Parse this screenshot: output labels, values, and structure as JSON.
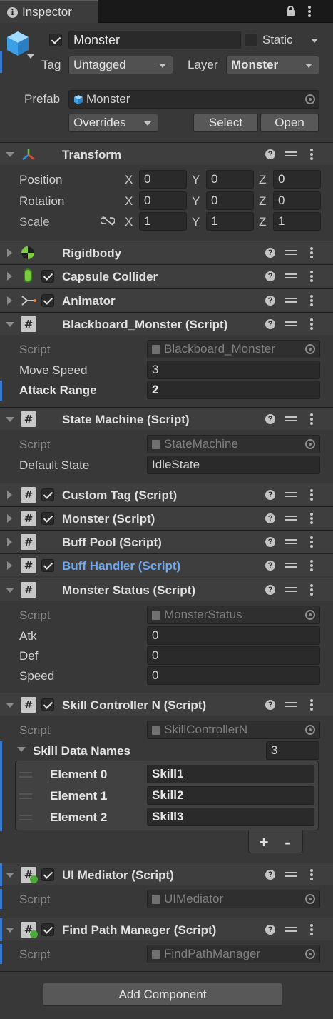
{
  "tab": {
    "title": "Inspector"
  },
  "object": {
    "name": "Monster",
    "static_label": "Static",
    "tag_label": "Tag",
    "tag_value": "Untagged",
    "layer_label": "Layer",
    "layer_value": "Monster",
    "prefab_label": "Prefab",
    "prefab_value": "Monster",
    "overrides": "Overrides",
    "select": "Select",
    "open": "Open"
  },
  "transform": {
    "title": "Transform",
    "position_label": "Position",
    "rotation_label": "Rotation",
    "scale_label": "Scale",
    "x": "X",
    "y": "Y",
    "z": "Z",
    "position": [
      "0",
      "0",
      "0"
    ],
    "rotation": [
      "0",
      "0",
      "0"
    ],
    "scale": [
      "1",
      "1",
      "1"
    ]
  },
  "components": {
    "rigidbody": "Rigidbody",
    "capsule": "Capsule Collider",
    "animator": "Animator",
    "blackboard": {
      "title": "Blackboard_Monster (Script)",
      "script_label": "Script",
      "script_value": "Blackboard_Monster",
      "move_label": "Move Speed",
      "move_value": "3",
      "attack_label": "Attack Range",
      "attack_value": "2"
    },
    "state_machine": {
      "title": "State Machine (Script)",
      "script_label": "Script",
      "script_value": "StateMachine",
      "default_label": "Default State",
      "default_value": "IdleState"
    },
    "custom_tag": "Custom Tag (Script)",
    "monster": "Monster (Script)",
    "buff_pool": "Buff Pool (Script)",
    "buff_handler": "Buff Handler (Script)",
    "monster_status": {
      "title": "Monster Status (Script)",
      "script_label": "Script",
      "script_value": "MonsterStatus",
      "atk_label": "Atk",
      "atk_value": "0",
      "def_label": "Def",
      "def_value": "0",
      "speed_label": "Speed",
      "speed_value": "0"
    },
    "skill_controller": {
      "title": "Skill Controller N (Script)",
      "script_label": "Script",
      "script_value": "SkillControllerN",
      "list_label": "Skill Data Names",
      "list_size": "3",
      "elements": [
        {
          "label": "Element 0",
          "value": "Skill1"
        },
        {
          "label": "Element 1",
          "value": "Skill2"
        },
        {
          "label": "Element 2",
          "value": "Skill3"
        }
      ],
      "plus": "+",
      "minus": "-"
    },
    "ui_mediator": {
      "title": "UI Mediator (Script)",
      "script_label": "Script",
      "script_value": "UIMediator"
    },
    "find_path": {
      "title": "Find Path Manager (Script)",
      "script_label": "Script",
      "script_value": "FindPathManager"
    }
  },
  "add_component": "Add Component",
  "colors": {
    "background": "#383838",
    "header": "#3e3e3e",
    "field": "#2a2a2a",
    "accent_blue": "#3a79d0",
    "link_blue": "#6fa8ef"
  }
}
